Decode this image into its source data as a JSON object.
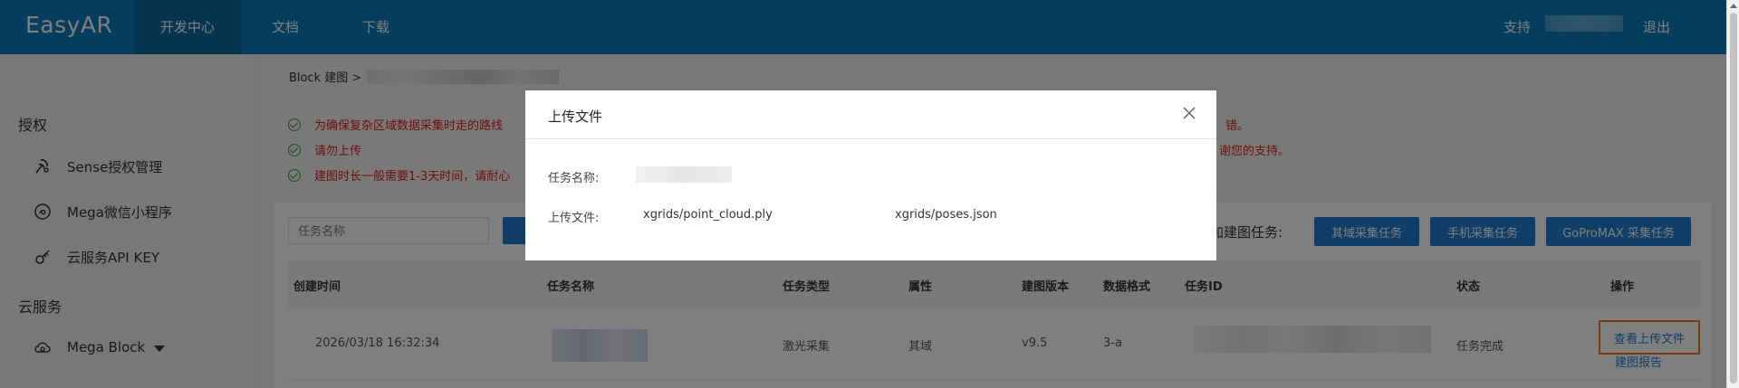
{
  "topbar": {
    "logo": "EasyAR",
    "nav": [
      "开发中心",
      "文档",
      "下载"
    ],
    "support": "支持",
    "logout": "退出"
  },
  "breadcrumb": {
    "text": "Block 建图 >"
  },
  "sidebar": {
    "section_auth": "授权",
    "items_auth": [
      "Sense授权管理",
      "Mega微信小程序",
      "云服务API KEY"
    ],
    "section_cloud": "云服务",
    "items_cloud": [
      "Mega Block"
    ]
  },
  "notices": [
    "为确保复杂区域数据采集时走的路线",
    "请勿上传",
    "建图时长一般需要1-3天时间，请耐心"
  ],
  "notices_tail": [
    "错。",
    "谢您的支持。"
  ],
  "toolbar": {
    "search_placeholder": "任务名称",
    "add_task_label": "添加建图任务:",
    "buttons": [
      "其域采集任务",
      "手机采集任务",
      "GoProMAX 采集任务"
    ]
  },
  "table": {
    "headers": [
      "创建时间",
      "任务名称",
      "任务类型",
      "属性",
      "建图版本",
      "数据格式",
      "任务ID",
      "状态",
      "操作"
    ],
    "row": {
      "created": "2026/03/18 16:32:34",
      "type": "激光采集",
      "attr": "其域",
      "version": "v9.5",
      "format": "3-a",
      "status": "任务完成",
      "action_view": "查看上传文件",
      "action_report": "建图报告"
    }
  },
  "modal": {
    "title": "上传文件",
    "task_name_label": "任务名称:",
    "upload_label": "上传文件:",
    "files": [
      "xgrids/point_cloud.ply",
      "xgrids/poses.json"
    ]
  },
  "colors": {
    "topbar": "#0a7dba",
    "primary_button": "#1f7ccc",
    "notice_text": "#e02020",
    "highlight": "#f07828"
  }
}
